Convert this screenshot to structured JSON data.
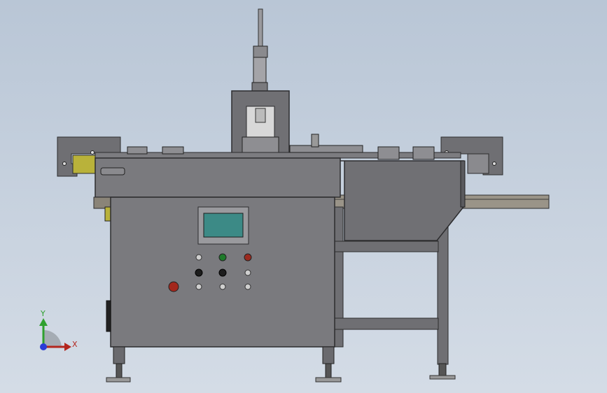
{
  "viewport": {
    "background_top": "#b9c6d6",
    "background_bottom": "#d4dce6"
  },
  "colors": {
    "frame": "#6f6f73",
    "frame_dark": "#4e4e52",
    "panel": "#7a7a7e",
    "edge": "#2c2c2e",
    "screen": "#3c8a86",
    "sensor_yellow": "#b9b23a",
    "button_green": "#1e7a2a",
    "button_red": "#9b2a1f",
    "button_black": "#1d1d1d",
    "estop_red": "#a3271c"
  },
  "machine": {
    "nameplate_text": "",
    "screen_label_text": ""
  },
  "control_panel": {
    "buttons": [
      {
        "name": "indicator-white-1",
        "color": "#cfcfcf"
      },
      {
        "name": "button-green",
        "color": "#1e7a2a"
      },
      {
        "name": "button-red",
        "color": "#9b2a1f"
      },
      {
        "name": "button-black-1",
        "color": "#1d1d1d"
      },
      {
        "name": "button-black-2",
        "color": "#1d1d1d"
      },
      {
        "name": "indicator-white-2",
        "color": "#cfcfcf"
      },
      {
        "name": "indicator-white-3",
        "color": "#cfcfcf"
      },
      {
        "name": "indicator-white-4",
        "color": "#cfcfcf"
      },
      {
        "name": "indicator-white-5",
        "color": "#cfcfcf"
      }
    ]
  },
  "triad": {
    "y_label": "Y",
    "x_label": "X",
    "y_color": "#2fa12f",
    "x_color": "#b3261e",
    "z_color": "#2a3bd6"
  }
}
